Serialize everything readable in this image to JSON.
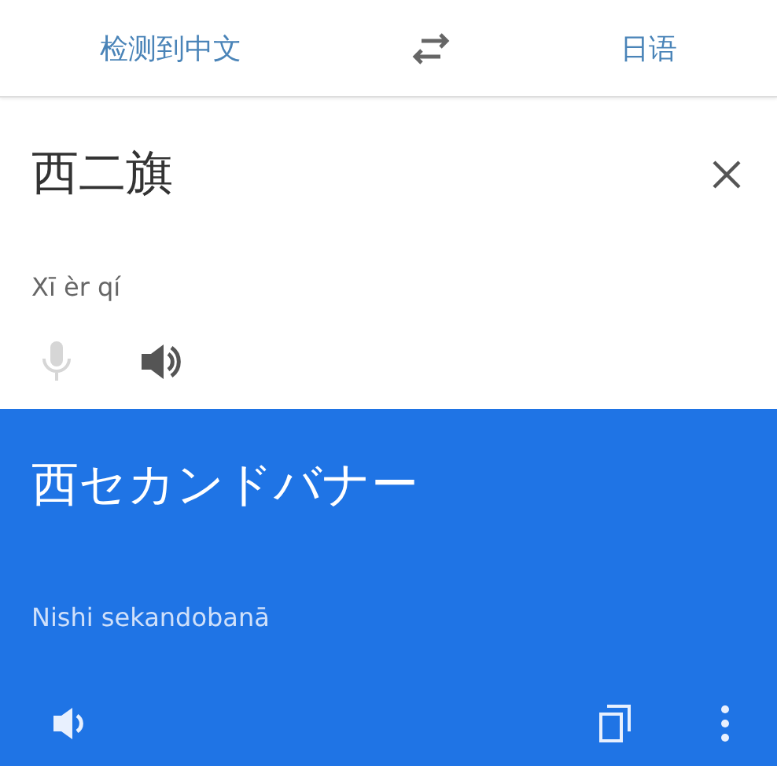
{
  "language_bar": {
    "source": "检测到中文",
    "target": "日语"
  },
  "input": {
    "text": "西二旗",
    "pinyin": "Xī èr qí",
    "mic": {
      "disabled": true
    }
  },
  "output": {
    "text": "西セカンドバナー",
    "romanization": "Nishi sekandobanā"
  }
}
